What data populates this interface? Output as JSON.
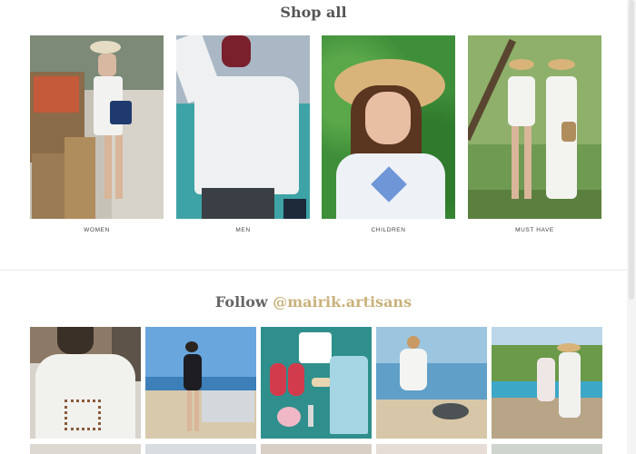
{
  "shop": {
    "title": "Shop all",
    "categories": [
      {
        "label": "WOMEN"
      },
      {
        "label": "MEN"
      },
      {
        "label": "CHILDREN"
      },
      {
        "label": "MUST HAVE"
      }
    ]
  },
  "follow": {
    "prefix": "Follow ",
    "handle": "@mairik.artisans"
  },
  "colors": {
    "accent": "#c9b27c",
    "sea": "#3aa6a8",
    "leaf": "#3f8f3a",
    "embroidery": "#4f7fd0"
  }
}
